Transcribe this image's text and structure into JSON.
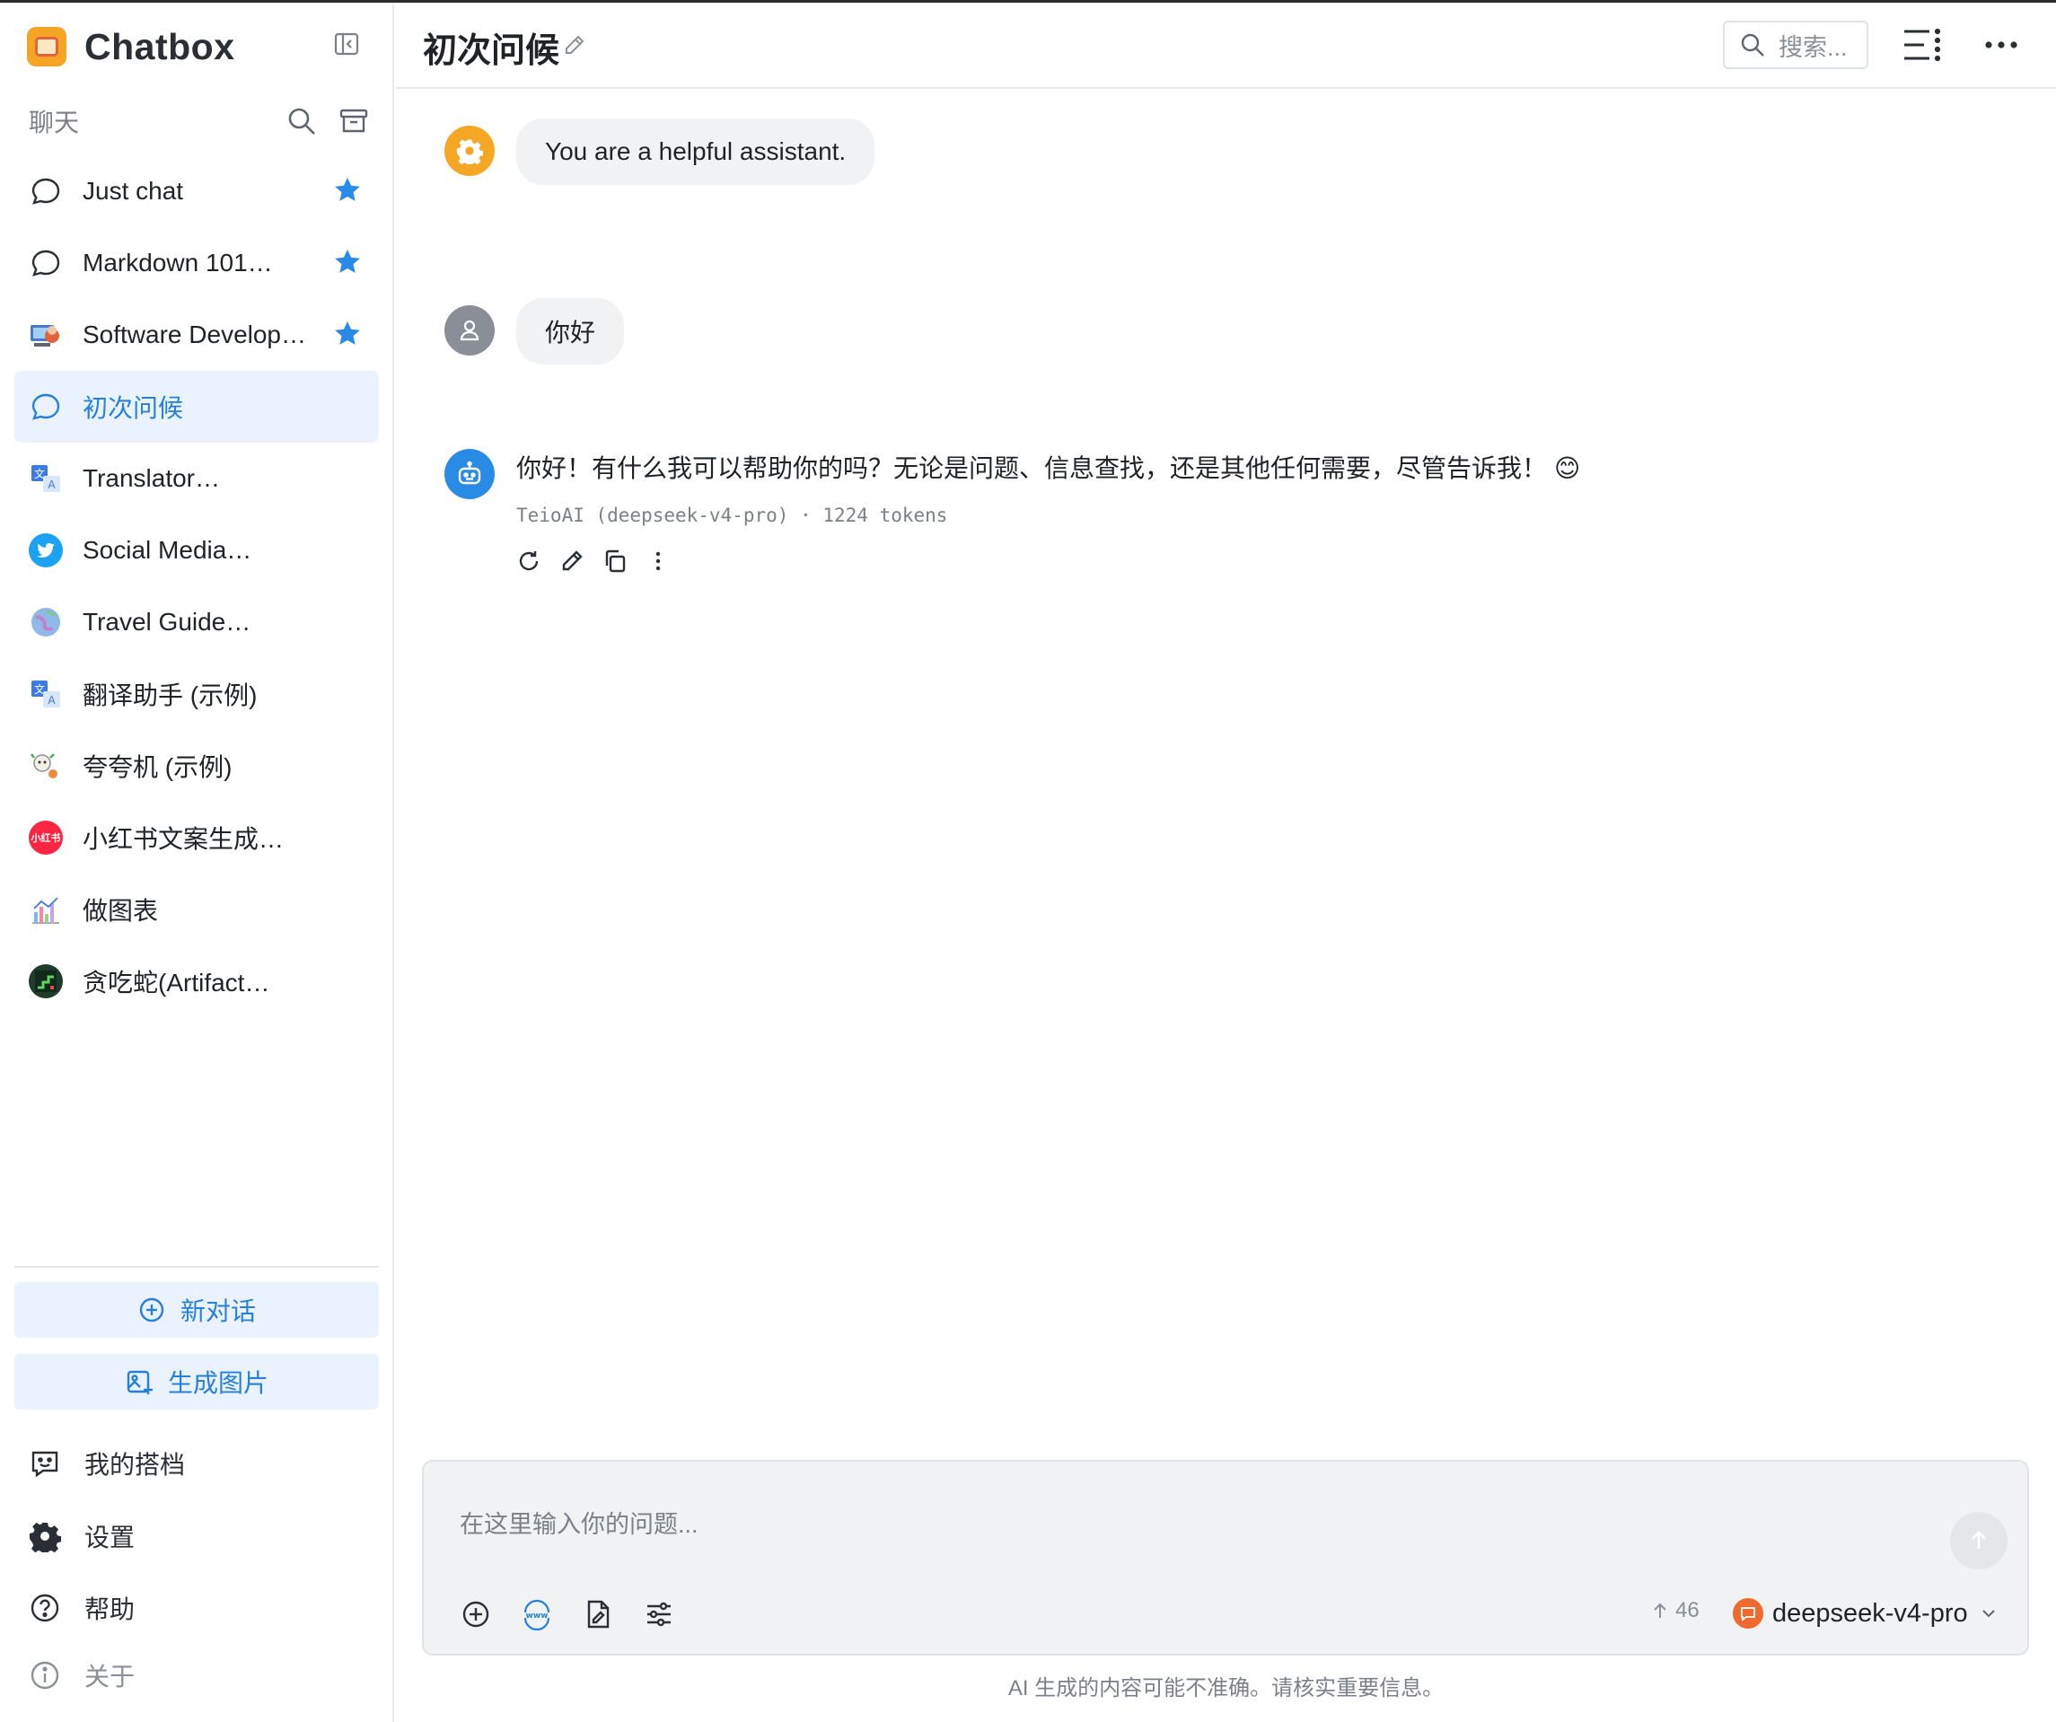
{
  "app": {
    "name": "Chatbox"
  },
  "sidebar": {
    "section_title": "聊天",
    "sessions": [
      {
        "label": "Just chat",
        "starred": true,
        "icon": "chat-bubble-icon"
      },
      {
        "label": "Markdown 101…",
        "starred": true,
        "icon": "chat-bubble-icon"
      },
      {
        "label": "Software Develop…",
        "starred": true,
        "icon": "developer-avatar"
      },
      {
        "label": "初次问候",
        "starred": false,
        "active": true,
        "icon": "chat-bubble-icon"
      },
      {
        "label": "Translator…",
        "starred": false,
        "icon": "translate-avatar"
      },
      {
        "label": "Social Media…",
        "starred": false,
        "icon": "twitter-avatar"
      },
      {
        "label": "Travel Guide…",
        "starred": false,
        "icon": "globe-avatar"
      },
      {
        "label": "翻译助手 (示例)",
        "starred": false,
        "icon": "translate-avatar"
      },
      {
        "label": "夸夸机 (示例)",
        "starred": false,
        "icon": "cheer-avatar"
      },
      {
        "label": "小红书文案生成…",
        "starred": false,
        "icon": "xiaohongshu-avatar",
        "avatar_text": "小红书"
      },
      {
        "label": "做图表",
        "starred": false,
        "icon": "chart-avatar"
      },
      {
        "label": "贪吃蛇(Artifact…",
        "starred": false,
        "icon": "snake-avatar"
      }
    ],
    "new_chat_label": "新对话",
    "generate_image_label": "生成图片",
    "copilots_label": "我的搭档",
    "settings_label": "设置",
    "help_label": "帮助",
    "about_label": "关于"
  },
  "header": {
    "title": "初次问候",
    "search_placeholder": "搜索..."
  },
  "messages": {
    "system": "You are a helpful assistant.",
    "user": "你好",
    "assistant": "你好！有什么我可以帮助你的吗？无论是问题、信息查找，还是其他任何需要，尽管告诉我！",
    "assistant_emoji": "😊",
    "assistant_meta": "TeioAI (deepseek-v4-pro) · 1224 tokens"
  },
  "input": {
    "placeholder": "在这里输入你的问题...",
    "token_count": "46",
    "model": "deepseek-v4-pro"
  },
  "footer": {
    "disclaimer": "AI 生成的内容可能不准确。请核实重要信息。"
  },
  "colors": {
    "accent": "#2680d9",
    "star": "#2a8be6",
    "active_bg": "#eaf3fd",
    "system_avatar": "#f5a623",
    "user_avatar": "#8a8f97",
    "assistant_avatar": "#2a8be6",
    "model_badge": "#f06a30"
  }
}
